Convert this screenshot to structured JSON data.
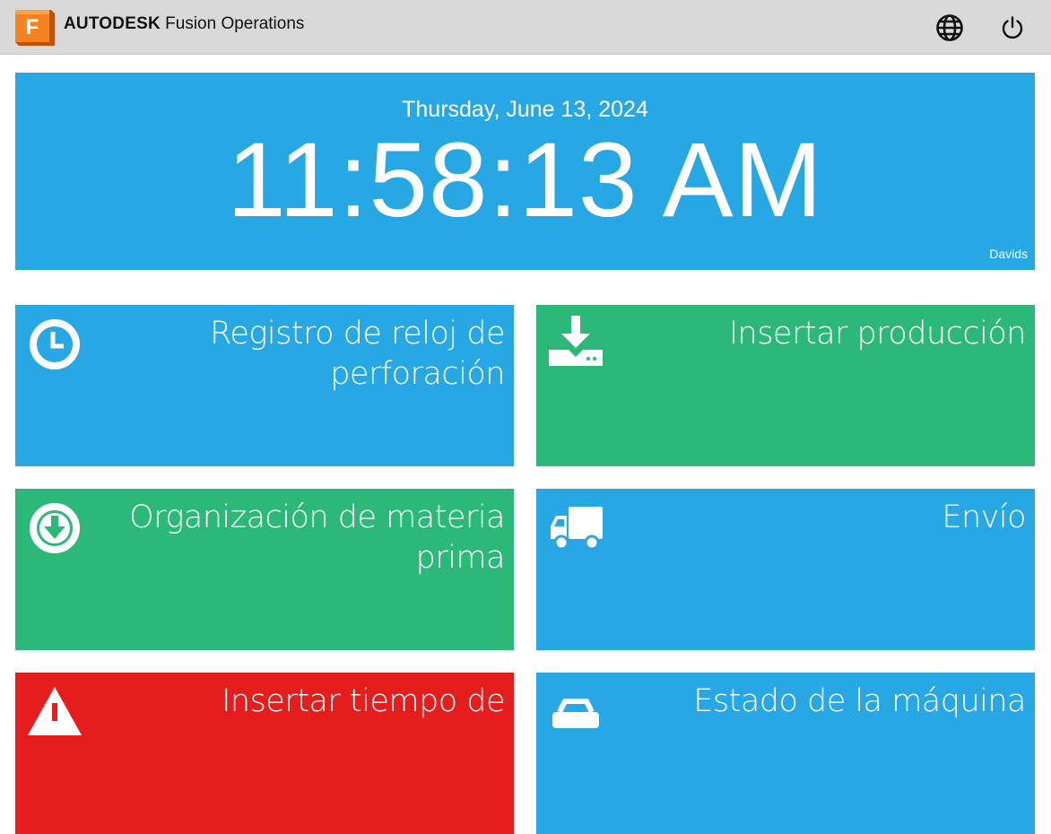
{
  "header": {
    "brand_bold": "AUTODESK",
    "brand_rest": "Fusion Operations",
    "logo_letter": "F",
    "icons": [
      "globe-icon",
      "power-icon"
    ]
  },
  "clock": {
    "date": "Thursday, June 13, 2024",
    "time": "11:58:13 AM",
    "user": "Davids"
  },
  "tiles": [
    {
      "label": "Registro de reloj de perforación",
      "icon": "clock-icon",
      "color": "#27a7e3"
    },
    {
      "label": "Insertar producción",
      "icon": "download-tray-icon",
      "color": "#2bb878"
    },
    {
      "label": "Organización de materia prima",
      "icon": "arrow-down-circle-icon",
      "color": "#2bb878"
    },
    {
      "label": "Envío",
      "icon": "truck-icon",
      "color": "#27a7e3"
    },
    {
      "label": "Insertar tiempo de",
      "icon": "warning-icon",
      "color": "#e51d1d"
    },
    {
      "label": "Estado de la máquina",
      "icon": "machine-icon",
      "color": "#27a7e3"
    }
  ],
  "colors": {
    "header_bg": "#d9d9d9",
    "blue": "#27a7e3",
    "green": "#2bb878",
    "red": "#e51d1d"
  }
}
